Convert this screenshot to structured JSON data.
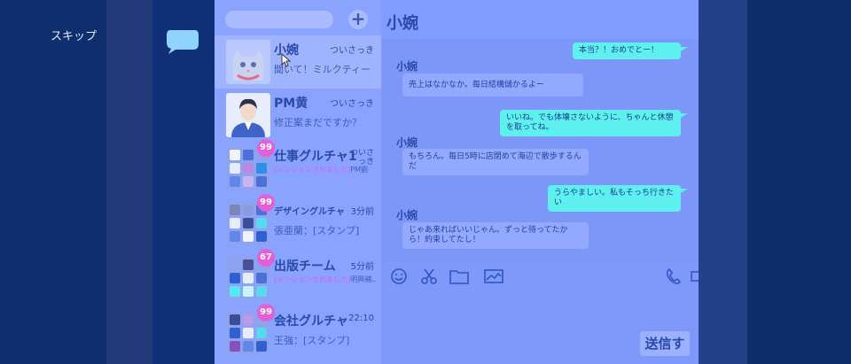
{
  "overlay": {
    "skip_label": "スキップ"
  },
  "chat": {
    "title": "小婉",
    "messages": [
      {
        "from": "me",
        "text": "本当？！おめでとー！"
      },
      {
        "from": "them",
        "sender": "小婉",
        "text": "売上はなかなか。毎日結構儲かるよー"
      },
      {
        "from": "me",
        "text": "いいね。でも体壊さないように、ちゃんと休憩を取ってね。"
      },
      {
        "from": "them",
        "sender": "小婉",
        "text": "もちろん。毎日5時に店閉めて海辺で散歩するんだ"
      },
      {
        "from": "me",
        "text": "うらやましい。私もそっち行きたい"
      },
      {
        "from": "them",
        "sender": "小婉",
        "text": "じゃあ来ればいいじゃん。ずっと待ってたから！約束してたし！"
      }
    ]
  },
  "conversations": [
    {
      "name": "小婉",
      "time": "ついさっき",
      "preview": "聞いて！ミルクティー",
      "avatar": "cat-avatar"
    },
    {
      "name": "PM黄",
      "time": "ついさっき",
      "preview": "修正案まだですか？",
      "avatar": "person-avatar"
    },
    {
      "name": "仕事グルチャ1",
      "time": "ついさっき",
      "badge": "99",
      "mention": "[メンションされました]",
      "preview": "PM劉"
    },
    {
      "name": "デザイングルチャ",
      "time": "3分前",
      "badge": "99",
      "preview": "張亜蘭：[スタンプ]"
    },
    {
      "name": "出版チーム",
      "time": "5分前",
      "badge": "67",
      "mention": "[メンションされました]",
      "preview": "明興補..."
    },
    {
      "name": "会社グルチャ",
      "time": "22:10",
      "badge": "99",
      "preview": "王強：[スタンプ]"
    }
  ],
  "compose": {
    "send_label": "送信す"
  },
  "colors": {
    "accent_cyan": "#5ef0ef",
    "badge_pink": "#e35fd8",
    "text_blue": "#2a4aa8"
  }
}
